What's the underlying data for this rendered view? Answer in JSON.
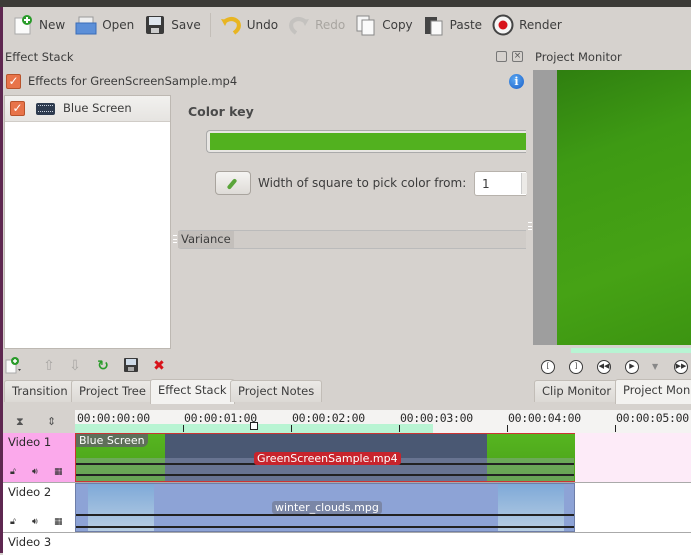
{
  "toolbar": {
    "new": "New",
    "open": "Open",
    "save": "Save",
    "undo": "Undo",
    "redo": "Redo",
    "copy": "Copy",
    "paste": "Paste",
    "render": "Render"
  },
  "effect_stack": {
    "title": "Effect Stack",
    "header_label": "Effects for GreenScreenSample.mp4",
    "header_enabled": true,
    "effects": [
      {
        "label": "Blue Screen",
        "enabled": true
      }
    ],
    "params": {
      "color_key_label": "Color key",
      "color_key_value": "#52b11f",
      "picker_label": "Width of square to pick color from:",
      "picker_value": "1",
      "variance_label": "Variance"
    }
  },
  "bottom_tabs": [
    {
      "label": "Transition",
      "active": false
    },
    {
      "label": "Project Tree",
      "active": false
    },
    {
      "label": "Effect Stack",
      "active": true
    },
    {
      "label": "Project Notes",
      "active": false
    }
  ],
  "monitor": {
    "title": "Project Monitor",
    "tabs": [
      {
        "label": "Clip Monitor",
        "active": false
      },
      {
        "label": "Project Monitor",
        "active": true
      }
    ]
  },
  "timeline": {
    "ruler": [
      "00:00:00:00",
      "00:00:01:00",
      "00:00:02:00",
      "00:00:03:00",
      "00:00:04:00",
      "00:00:05:00"
    ],
    "tracks": [
      {
        "name": "Video 1",
        "clips": [
          {
            "label": "GreenScreenSample.mp4",
            "effect_label": "Blue Screen"
          }
        ]
      },
      {
        "name": "Video 2",
        "clips": [
          {
            "label": "winter_clouds.mpg"
          }
        ]
      },
      {
        "name": "Video 3",
        "clips": []
      }
    ]
  }
}
